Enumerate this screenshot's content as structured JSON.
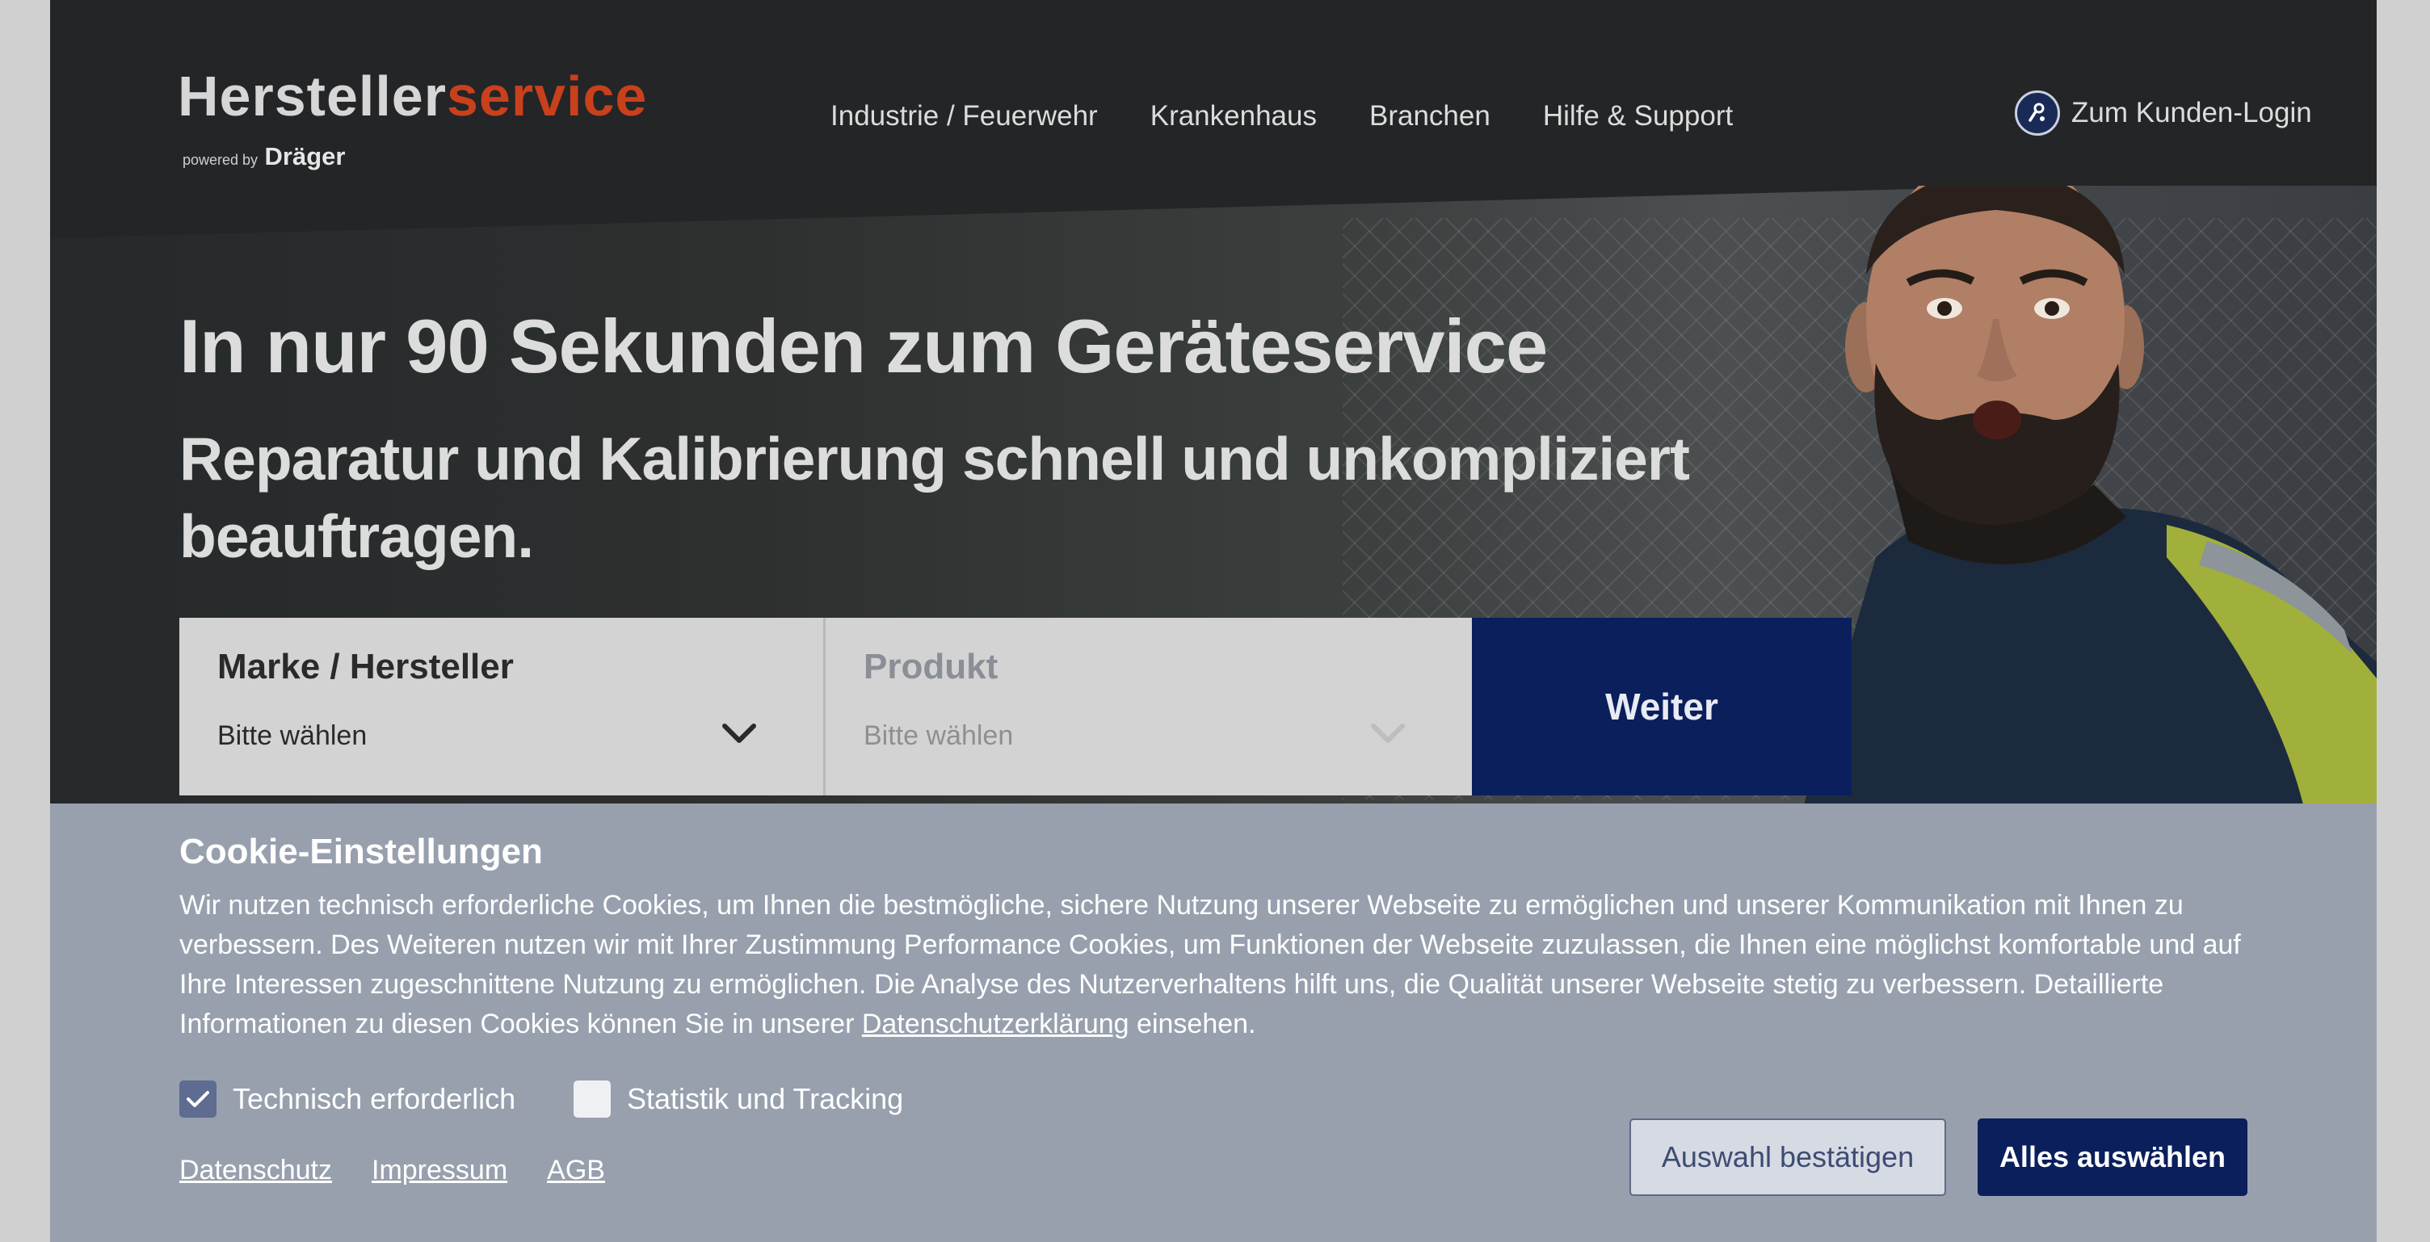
{
  "header": {
    "logo": {
      "part1": "Hersteller",
      "part2": "service",
      "powered_by": "powered by",
      "partner": "Dräger"
    },
    "nav": [
      {
        "label": "Industrie / Feuerwehr"
      },
      {
        "label": "Krankenhaus"
      },
      {
        "label": "Branchen"
      },
      {
        "label": "Hilfe & Support"
      }
    ],
    "login": {
      "label": "Zum Kunden-Login",
      "icon": "customer-login-icon"
    }
  },
  "hero": {
    "title": "In nur 90 Sekunden zum Geräteservice",
    "subtitle": "Reparatur und Kalibrierung schnell und unkompliziert beauftragen."
  },
  "selector": {
    "brand": {
      "label": "Marke / Hersteller",
      "value": "Bitte wählen",
      "icon": "chevron-down-icon"
    },
    "product": {
      "label": "Produkt",
      "value": "Bitte wählen",
      "disabled": true,
      "icon": "chevron-down-icon"
    },
    "submit": "Weiter"
  },
  "cookie": {
    "title": "Cookie-Einstellungen",
    "text_before_link": "Wir nutzen technisch erforderliche Cookies, um Ihnen die bestmögliche, sichere Nutzung unserer Webseite zu ermöglichen und unserer Kommunikation mit Ihnen zu verbessern. Des Weiteren nutzen wir mit Ihrer Zustimmung Performance Cookies, um Funktionen der Webseite zuzulassen, die Ihnen eine möglichst komfortable und auf Ihre Interessen zugeschnittene Nutzung zu ermöglichen. Die Analyse des Nutzerverhaltens hilft uns, die Qualität unserer Webseite stetig zu verbessern. Detaillierte Informationen zu diesen Cookies können Sie in unserer",
    "link": "Datenschutzerklärung",
    "text_after_link": "einsehen.",
    "options": [
      {
        "label": "Technisch erforderlich",
        "checked": true
      },
      {
        "label": "Statistik und Tracking",
        "checked": false
      }
    ],
    "footer_links": [
      "Datenschutz",
      "Impressum",
      "AGB"
    ],
    "buttons": {
      "confirm": "Auswahl bestätigen",
      "select_all": "Alles auswählen"
    }
  },
  "colors": {
    "header_bg": "#232527",
    "brand_orange": "#c9401c",
    "primary_navy": "#0a1f5c",
    "cookie_bg": "#98a0ae",
    "field_bg": "#d3d3d3"
  }
}
